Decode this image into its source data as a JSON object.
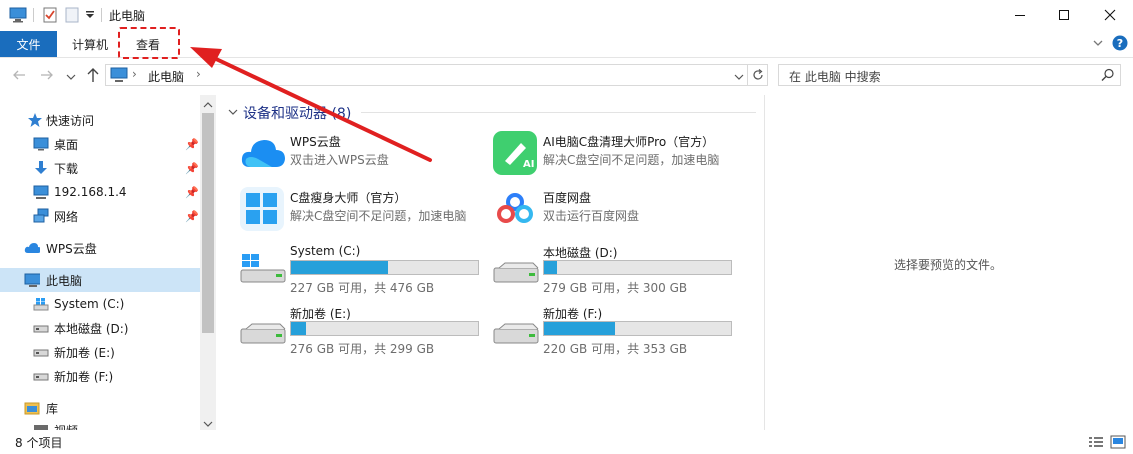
{
  "window": {
    "title": "此电脑"
  },
  "ribbon": {
    "tabs": [
      {
        "label": "文件"
      },
      {
        "label": "计算机"
      },
      {
        "label": "查看"
      }
    ]
  },
  "address": {
    "path": "此电脑",
    "search_placeholder": "在 此电脑 中搜索"
  },
  "nav": {
    "quick_access": "快速访问",
    "items": [
      {
        "label": "桌面",
        "icon": "desktop-icon",
        "pinned": true
      },
      {
        "label": "下载",
        "icon": "download-icon",
        "pinned": true
      },
      {
        "label": "192.168.1.4",
        "icon": "network-drive-icon",
        "pinned": true
      },
      {
        "label": "网络",
        "icon": "network-icon",
        "pinned": true
      }
    ],
    "wps": "WPS云盘",
    "this_pc": "此电脑",
    "drives": [
      {
        "label": "System (C:)"
      },
      {
        "label": "本地磁盘 (D:)"
      },
      {
        "label": "新加卷 (E:)"
      },
      {
        "label": "新加卷 (F:)"
      }
    ],
    "library": "库",
    "partial": "视频"
  },
  "content": {
    "group_header": "设备和驱动器 (8)",
    "apps": [
      {
        "name": "WPS云盘",
        "sub": "双击进入WPS云盘",
        "icon": "wps-cloud-icon"
      },
      {
        "name": "AI电脑C盘清理大师Pro（官方）",
        "sub": "解决C盘空间不足问题，加速电脑",
        "icon": "ai-cleaner-icon"
      },
      {
        "name": "C盘瘦身大师（官方）",
        "sub": "解决C盘空间不足问题，加速电脑",
        "icon": "c-slimming-icon"
      },
      {
        "name": "百度网盘",
        "sub": "双击运行百度网盘",
        "icon": "baidu-netdisk-icon"
      }
    ],
    "drives": [
      {
        "name": "System (C:)",
        "sub": "227 GB 可用，共 476 GB",
        "used_fraction": 0.52
      },
      {
        "name": "本地磁盘 (D:)",
        "sub": "279 GB 可用，共 300 GB",
        "used_fraction": 0.07
      },
      {
        "name": "新加卷 (E:)",
        "sub": "276 GB 可用，共 299 GB",
        "used_fraction": 0.08
      },
      {
        "name": "新加卷 (F:)",
        "sub": "220 GB 可用，共 353 GB",
        "used_fraction": 0.38
      }
    ]
  },
  "preview_text": "选择要预览的文件。",
  "status": {
    "count": "8 个项目"
  },
  "colors": {
    "accent": "#1a6dbd",
    "drive_fill": "#26a0da",
    "annotation_red": "#e02020"
  }
}
